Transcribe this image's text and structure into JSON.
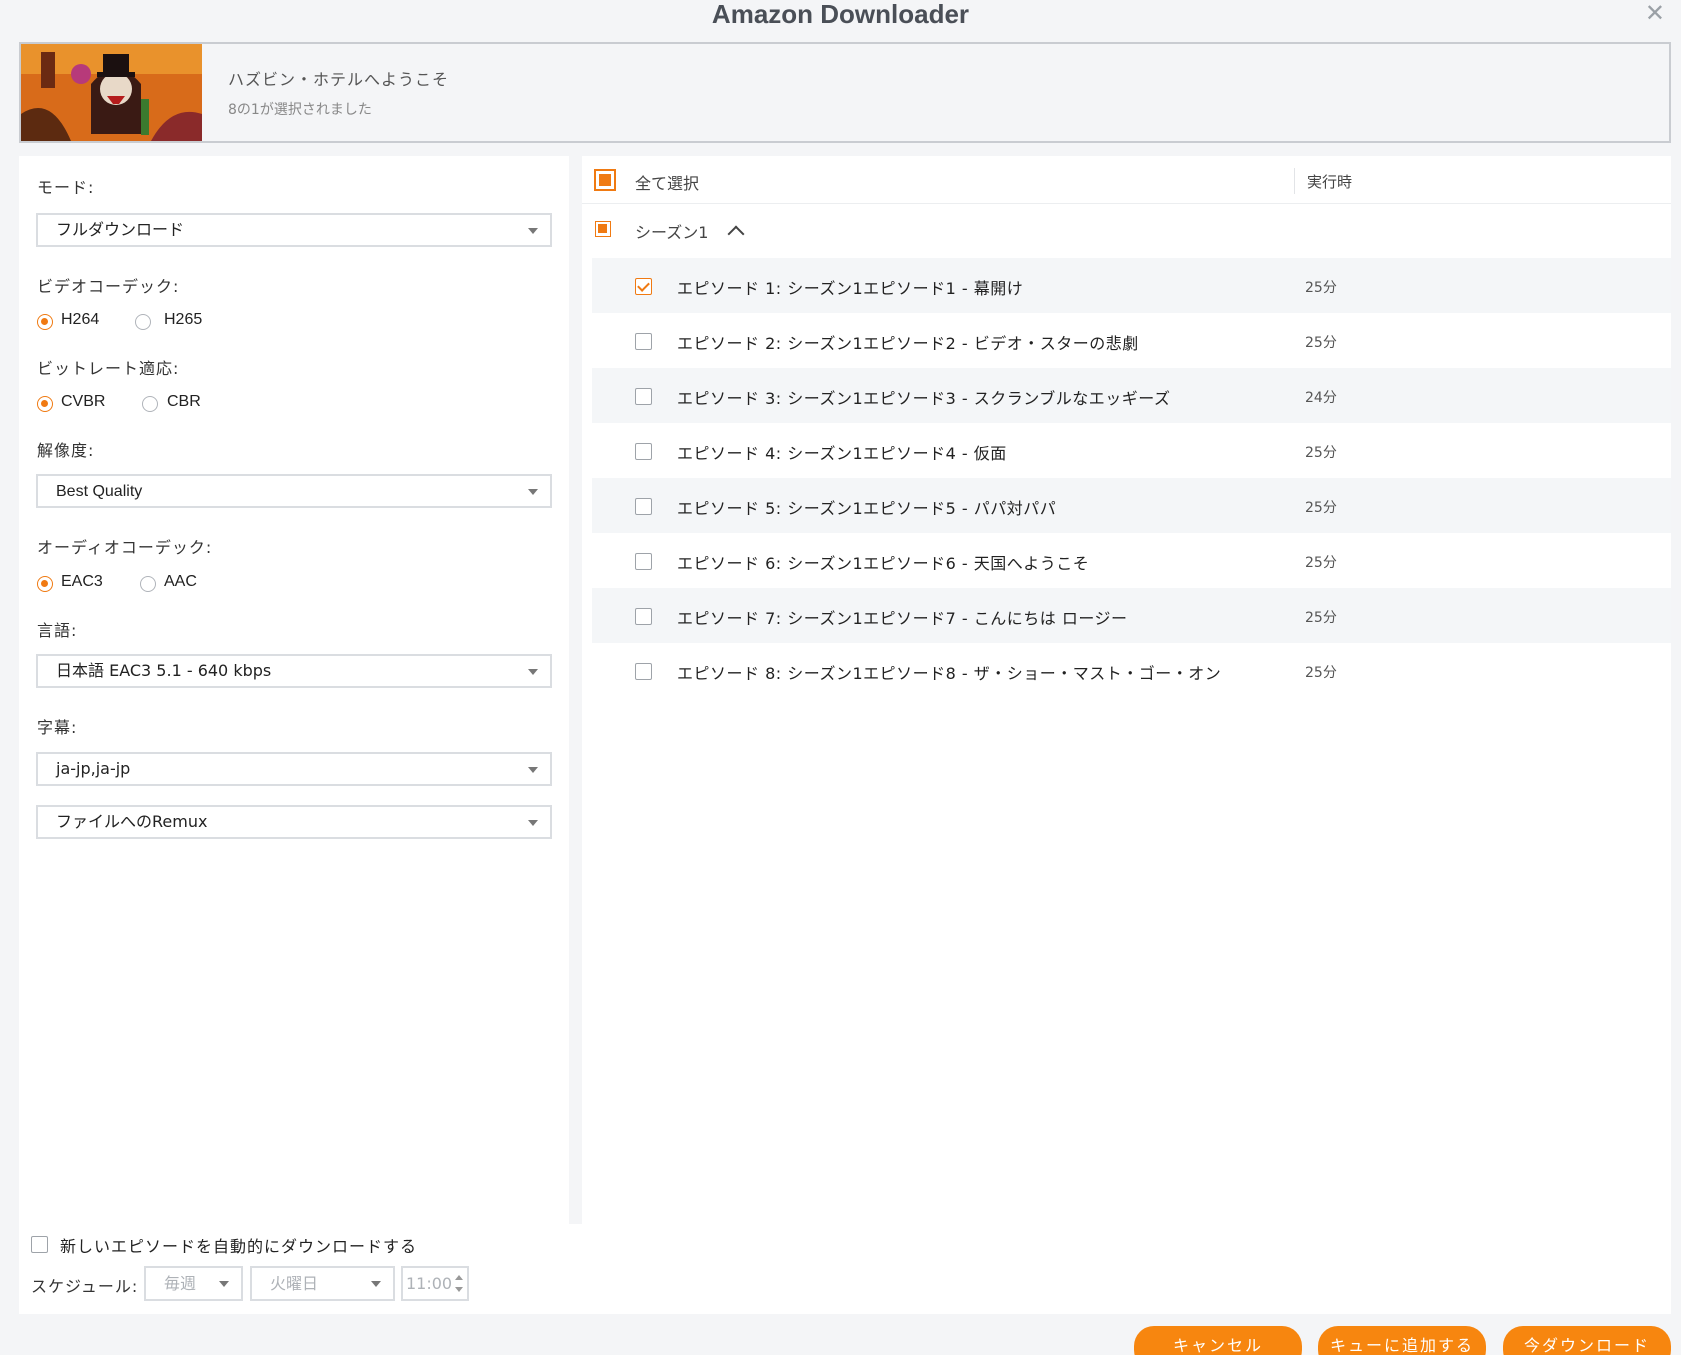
{
  "window": {
    "title": "Amazon Downloader",
    "close_glyph": "✕"
  },
  "header": {
    "title": "ハズビン・ホテルへようこそ",
    "subtitle": "8の1が選択されました"
  },
  "settings": {
    "mode_label": "モード:",
    "mode_value": "フルダウンロード",
    "video_codec_label": "ビデオコーデック:",
    "video_codec_options": [
      "H264",
      "H265"
    ],
    "video_codec_selected": "H264",
    "bitrate_label": "ビットレート適応:",
    "bitrate_options": [
      "CVBR",
      "CBR"
    ],
    "bitrate_selected": "CVBR",
    "resolution_label": "解像度:",
    "resolution_value": "Best Quality",
    "audio_codec_label": "オーディオコーデック:",
    "audio_codec_options": [
      "EAC3",
      "AAC"
    ],
    "audio_codec_selected": "EAC3",
    "language_label": "言語:",
    "language_value": "日本語 EAC3 5.1 - 640 kbps",
    "subtitle_label": "字幕:",
    "subtitle_value": "ja-jp,ja-jp",
    "subtitle_format_value": "ファイルへのRemux"
  },
  "list": {
    "select_all_label": "全て選択",
    "runtime_header": "実行時",
    "season_label": "シーズン1",
    "episodes": [
      {
        "title": "エピソード 1: シーズン1エピソード1 - 幕開け",
        "duration": "25分",
        "checked": true
      },
      {
        "title": "エピソード 2: シーズン1エピソード2 - ビデオ・スターの悲劇",
        "duration": "25分",
        "checked": false
      },
      {
        "title": "エピソード 3: シーズン1エピソード3 - スクランブルなエッギーズ",
        "duration": "24分",
        "checked": false
      },
      {
        "title": "エピソード 4: シーズン1エピソード4 - 仮面",
        "duration": "25分",
        "checked": false
      },
      {
        "title": "エピソード 5: シーズン1エピソード5 - パパ対パパ",
        "duration": "25分",
        "checked": false
      },
      {
        "title": "エピソード 6: シーズン1エピソード6 - 天国へようこそ",
        "duration": "25分",
        "checked": false
      },
      {
        "title": "エピソード 7: シーズン1エピソード7 - こんにちは ロージー",
        "duration": "25分",
        "checked": false
      },
      {
        "title": "エピソード 8: シーズン1エピソード8 - ザ・ショー・マスト・ゴー・オン",
        "duration": "25分",
        "checked": false
      }
    ]
  },
  "schedule": {
    "auto_download_label": "新しいエピソードを自動的にダウンロードする",
    "schedule_label": "スケジュール:",
    "frequency_value": "毎週",
    "day_value": "火曜日",
    "time_value": "11:00"
  },
  "buttons": {
    "cancel": "キャンセル",
    "add_queue": "キューに追加する",
    "download_now": "今ダウンロード"
  },
  "colors": {
    "accent": "#f07a12",
    "button": "#f7860f"
  }
}
